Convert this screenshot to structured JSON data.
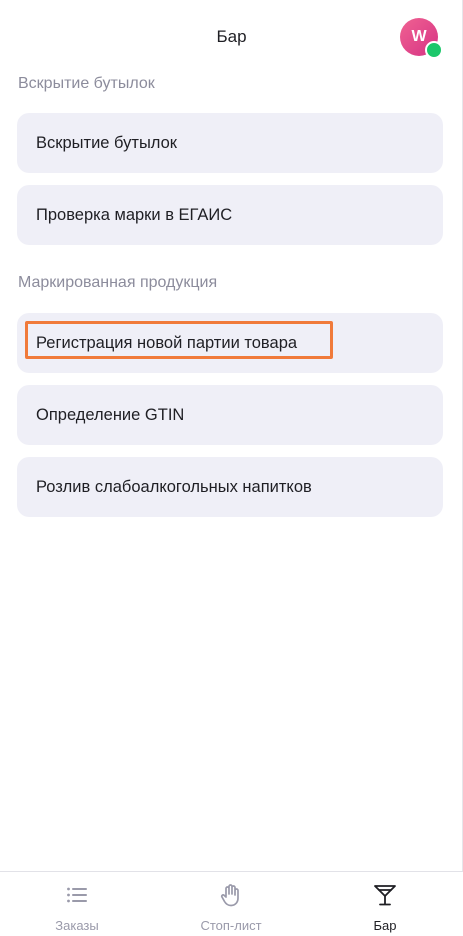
{
  "header": {
    "title": "Бар",
    "avatar_initial": "W"
  },
  "sections": [
    {
      "title": "Вскрытие бутылок",
      "items": [
        {
          "label": "Вскрытие бутылок"
        },
        {
          "label": "Проверка марки в ЕГАИС"
        }
      ]
    },
    {
      "title": "Маркированная продукция",
      "items": [
        {
          "label": "Регистрация новой партии товара",
          "highlighted": true
        },
        {
          "label": "Определение GTIN"
        },
        {
          "label": "Розлив слабоалкогольных напитков"
        }
      ]
    }
  ],
  "bottom_nav": {
    "items": [
      {
        "label": "Заказы",
        "icon": "list-icon",
        "active": false
      },
      {
        "label": "Стоп-лист",
        "icon": "hand-stop-icon",
        "active": false
      },
      {
        "label": "Бар",
        "icon": "cocktail-glass-icon",
        "active": true
      }
    ]
  },
  "colors": {
    "card_bg": "#efeff7",
    "highlight": "#f07a3a",
    "avatar": "#e05295",
    "status_online": "#1cc76b"
  }
}
